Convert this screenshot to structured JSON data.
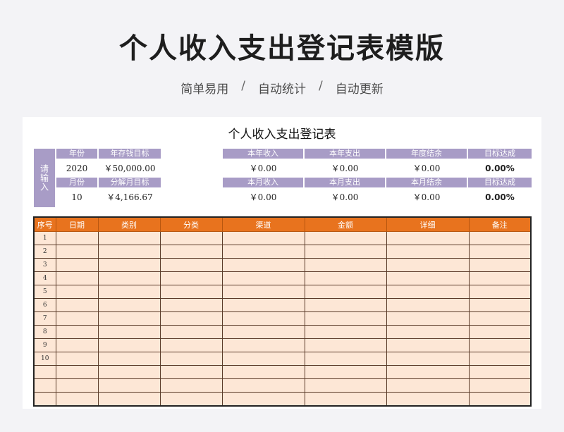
{
  "header": {
    "title": "个人收入支出登记表模版",
    "features": [
      "简单易用",
      "自动统计",
      "自动更新"
    ],
    "separator": "/"
  },
  "sheet": {
    "title": "个人收入支出登记表",
    "input_badge": "请输入",
    "inputs": {
      "year_label": "年份",
      "year_value": "2020",
      "target_label": "年存钱目标",
      "target_value": "￥50,000.00",
      "month_label": "月份",
      "month_value": "10",
      "monthly_target_label": "分解月目标",
      "monthly_target_value": "￥4,166.67"
    },
    "annual": {
      "income_label": "本年收入",
      "income_value": "￥0.00",
      "expense_label": "本年支出",
      "expense_value": "￥0.00",
      "balance_label": "年度结余",
      "balance_value": "￥0.00",
      "goal_label": "目标达成",
      "goal_value": "0.00%"
    },
    "monthly": {
      "income_label": "本月收入",
      "income_value": "￥0.00",
      "expense_label": "本月支出",
      "expense_value": "￥0.00",
      "balance_label": "本月结余",
      "balance_value": "￥0.00",
      "goal_label": "目标达成",
      "goal_value": "0.00%"
    }
  },
  "table": {
    "columns": [
      "序号",
      "日期",
      "类别",
      "分类",
      "渠道",
      "金额",
      "详细",
      "备注"
    ],
    "row_numbers": [
      "1",
      "2",
      "3",
      "4",
      "5",
      "6",
      "7",
      "8",
      "9",
      "10",
      "",
      "",
      ""
    ]
  },
  "colors": {
    "accent_purple": "#a89cc6",
    "accent_orange": "#e8731e",
    "row_fill": "#fde7d6"
  }
}
